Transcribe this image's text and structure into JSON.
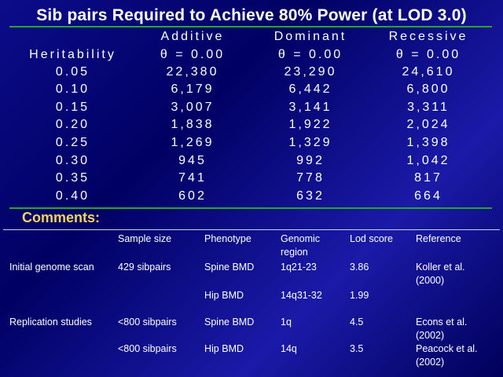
{
  "title": "Sib pairs Required to Achieve 80% Power (at LOD 3.0)",
  "power_table": {
    "header": [
      "",
      "Additive",
      "Dominant",
      "Recessive"
    ],
    "rows": [
      [
        "Heritability",
        "θ = 0.00",
        "θ = 0.00",
        "θ = 0.00"
      ],
      [
        "0.05",
        "22,380",
        "23,290",
        "24,610"
      ],
      [
        "0.10",
        "6,179",
        "6,442",
        "6,800"
      ],
      [
        "0.15",
        "3,007",
        "3,141",
        "3,311"
      ],
      [
        "0.20",
        "1,838",
        "1,922",
        "2,024"
      ],
      [
        "0.25",
        "1,269",
        "1,329",
        "1,398"
      ],
      [
        "0.30",
        "945",
        "992",
        "1,042"
      ],
      [
        "0.35",
        "741",
        "778",
        "817"
      ],
      [
        "0.40",
        "602",
        "632",
        "664"
      ]
    ]
  },
  "comments_label": "Comments:",
  "comments_table": {
    "header": [
      "",
      "Sample size",
      "Phenotype",
      "Genomic region",
      "Lod score",
      "Reference"
    ],
    "rows": [
      [
        "Initial genome scan",
        "429 sibpairs",
        "Spine BMD",
        "1q21-23",
        "3.86",
        "Koller et al. (2000)"
      ],
      [
        "",
        "",
        "Hip BMD",
        "14q31-32",
        "1.99",
        ""
      ],
      [
        "Replication studies",
        "<800 sibpairs",
        "Spine BMD",
        "1q",
        "4.5",
        "Econs et al. (2002)"
      ],
      [
        "",
        "<800 sibpairs",
        "Hip BMD",
        "14q",
        "3.5",
        "Peacock et al. (2002)"
      ]
    ]
  },
  "colors": {
    "background": "#00006e",
    "rule": "#2aa52a",
    "comments": "#f2d45c",
    "text": "#ffffff"
  }
}
